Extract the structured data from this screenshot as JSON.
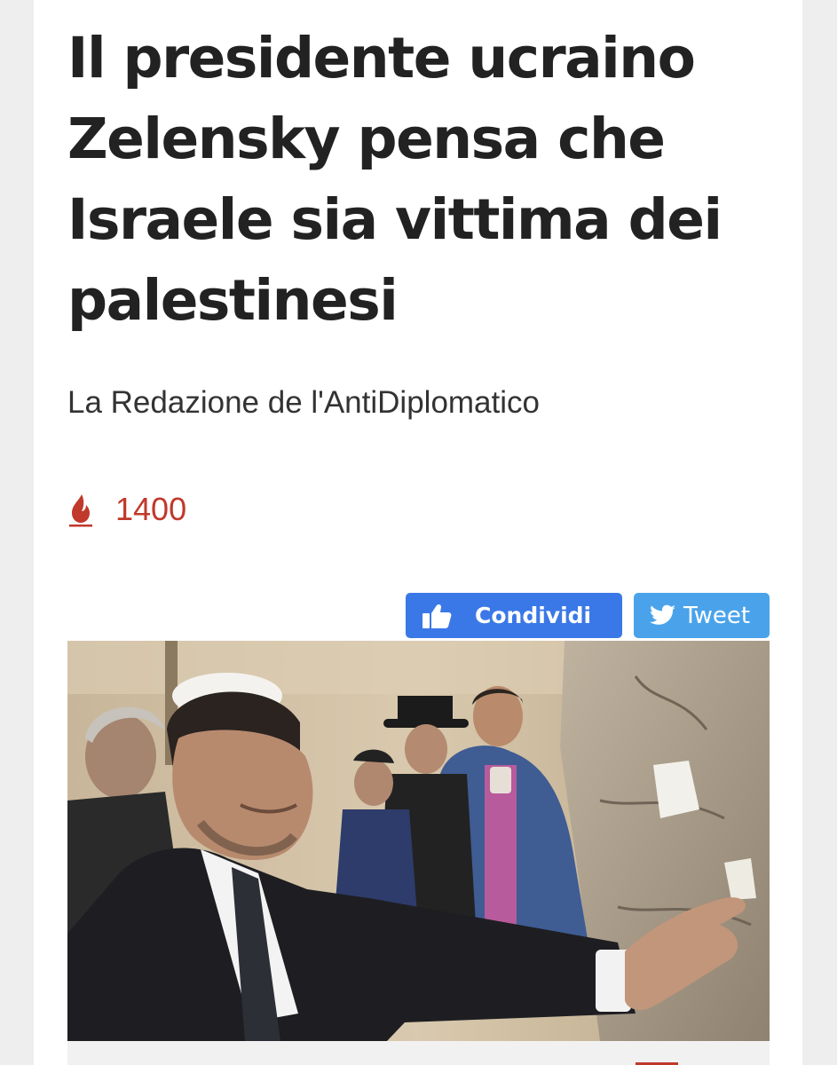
{
  "article": {
    "title_lines": [
      "Il presidente ucraino",
      "Zelensky pensa che",
      "Israele sia vittima dei",
      "palestinesi"
    ],
    "author": "La Redazione de l'AntiDiplomatico",
    "views_icon": "flame-icon",
    "views_count": "1400"
  },
  "share": {
    "facebook": {
      "label": "Condividi",
      "icon": "thumbs-up-icon"
    },
    "twitter": {
      "label": "Tweet",
      "icon": "twitter-bird-icon"
    }
  },
  "colors": {
    "accent_red": "#c0392b",
    "facebook_blue": "#3b78e7",
    "twitter_blue": "#4aa3ea",
    "title_text": "#222222"
  }
}
